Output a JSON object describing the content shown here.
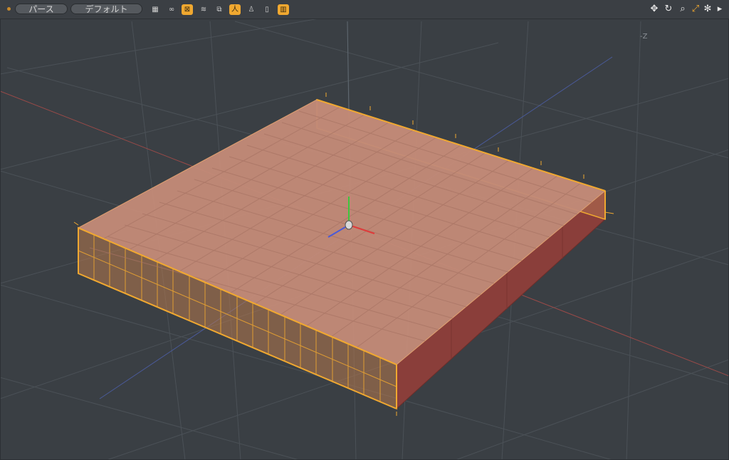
{
  "toolbar": {
    "view_button": "パース",
    "shading_button": "デフォルト",
    "icons": [
      {
        "name": "checker-icon",
        "glyph": "▦",
        "active": false
      },
      {
        "name": "rings-icon",
        "glyph": "∞",
        "active": false
      },
      {
        "name": "box-x-icon",
        "glyph": "⊠",
        "active": true
      },
      {
        "name": "hatch-icon",
        "glyph": "≋",
        "active": false
      },
      {
        "name": "layers-icon",
        "glyph": "⧉",
        "active": false
      },
      {
        "name": "person-icon",
        "glyph": "人",
        "active": true
      },
      {
        "name": "figure-icon",
        "glyph": "♙",
        "active": false
      },
      {
        "name": "clip-icon",
        "glyph": "▯",
        "active": false
      },
      {
        "name": "book-icon",
        "glyph": "▥",
        "active": true
      }
    ],
    "nav_icons": [
      {
        "name": "move-icon",
        "glyph": "✥",
        "accent": false
      },
      {
        "name": "rotate-icon",
        "glyph": "↻",
        "accent": false
      },
      {
        "name": "zoom-icon",
        "glyph": "⌕",
        "accent": false
      },
      {
        "name": "maximize-icon",
        "glyph": "⤢",
        "accent": true
      },
      {
        "name": "gear-icon",
        "glyph": "✻",
        "accent": false
      },
      {
        "name": "play-arrow-icon",
        "glyph": "▸",
        "accent": false
      }
    ]
  },
  "viewport": {
    "axis_label": "-Z",
    "background_color": "#3a3f44",
    "selection_color": "#f0a830",
    "face_color": "#c38a78",
    "side_color": "#8a3e3a"
  }
}
